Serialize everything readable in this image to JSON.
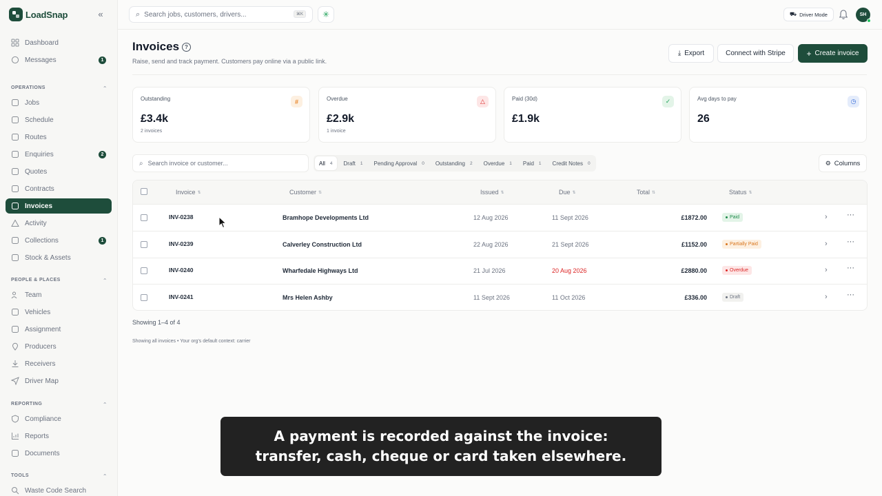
{
  "app": {
    "name": "LoadSnap"
  },
  "topbar": {
    "search_placeholder": "Search jobs, customers, drivers...",
    "search_shortcut": "⌘K",
    "driver_mode_label": "Driver Mode",
    "avatar_initials": "SH"
  },
  "sidebar": {
    "top_items": [
      {
        "label": "Dashboard",
        "icon": "dashboard-icon",
        "badge": ""
      },
      {
        "label": "Messages",
        "icon": "message-icon",
        "badge": "1"
      }
    ],
    "sections": [
      {
        "title": "OPERATIONS",
        "items": [
          {
            "label": "Jobs",
            "icon": "clipboard-icon",
            "badge": ""
          },
          {
            "label": "Schedule",
            "icon": "calendar-icon",
            "badge": ""
          },
          {
            "label": "Routes",
            "icon": "route-icon",
            "badge": ""
          },
          {
            "label": "Enquiries",
            "icon": "inbox-icon",
            "badge": "2"
          },
          {
            "label": "Quotes",
            "icon": "document-icon",
            "badge": ""
          },
          {
            "label": "Contracts",
            "icon": "contract-icon",
            "badge": ""
          },
          {
            "label": "Invoices",
            "icon": "invoice-icon",
            "badge": "",
            "active": true
          },
          {
            "label": "Activity",
            "icon": "activity-icon",
            "badge": ""
          },
          {
            "label": "Collections",
            "icon": "collections-icon",
            "badge": "1"
          },
          {
            "label": "Stock & Assets",
            "icon": "box-icon",
            "badge": ""
          }
        ]
      },
      {
        "title": "PEOPLE & PLACES",
        "items": [
          {
            "label": "Team",
            "icon": "team-icon",
            "badge": ""
          },
          {
            "label": "Vehicles",
            "icon": "truck-icon",
            "badge": ""
          },
          {
            "label": "Assignment",
            "icon": "assignment-icon",
            "badge": ""
          },
          {
            "label": "Producers",
            "icon": "pin-icon",
            "badge": ""
          },
          {
            "label": "Receivers",
            "icon": "download-icon",
            "badge": ""
          },
          {
            "label": "Driver Map",
            "icon": "navigation-icon",
            "badge": ""
          }
        ]
      },
      {
        "title": "REPORTING",
        "items": [
          {
            "label": "Compliance",
            "icon": "shield-icon",
            "badge": ""
          },
          {
            "label": "Reports",
            "icon": "bar-chart-icon",
            "badge": ""
          },
          {
            "label": "Documents",
            "icon": "file-icon",
            "badge": ""
          }
        ]
      },
      {
        "title": "TOOLS",
        "items": [
          {
            "label": "Waste Code Search",
            "icon": "search-icon",
            "badge": ""
          }
        ]
      }
    ]
  },
  "page": {
    "title": "Invoices",
    "subtitle": "Raise, send and track payment. Customers pay online via a public link.",
    "export_label": "Export",
    "stripe_label": "Connect with Stripe",
    "create_label": "Create invoice"
  },
  "kpis": [
    {
      "label": "Outstanding",
      "value": "£3.4k",
      "sub": "2 invoices",
      "icon": "#",
      "icon_name": "hash-icon",
      "bg": "#fdf0e1",
      "fg": "#e8862a"
    },
    {
      "label": "Overdue",
      "value": "£2.9k",
      "sub": "1 invoice",
      "icon": "△",
      "icon_name": "warning-icon",
      "bg": "#fde6e6",
      "fg": "#dc2626"
    },
    {
      "label": "Paid (30d)",
      "value": "£1.9k",
      "sub": "",
      "icon": "✓",
      "icon_name": "check-circle-icon",
      "bg": "#e3f4e8",
      "fg": "#22a35a"
    },
    {
      "label": "Avg days to pay",
      "value": "26",
      "sub": "",
      "icon": "◷",
      "icon_name": "clock-icon",
      "bg": "#e4ecfb",
      "fg": "#3b6fd8"
    }
  ],
  "filters": {
    "search_placeholder": "Search invoice or customer...",
    "chips": [
      {
        "label": "All",
        "count": "4",
        "active": true
      },
      {
        "label": "Draft",
        "count": "1"
      },
      {
        "label": "Pending Approval",
        "count": "0"
      },
      {
        "label": "Outstanding",
        "count": "2"
      },
      {
        "label": "Overdue",
        "count": "1"
      },
      {
        "label": "Paid",
        "count": "1"
      },
      {
        "label": "Credit Notes",
        "count": "0"
      }
    ],
    "columns_label": "Columns"
  },
  "table": {
    "headers": [
      "Invoice",
      "Customer",
      "Issued",
      "Due",
      "Total",
      "Status"
    ],
    "rows": [
      {
        "invoice": "INV-0238",
        "customer": "Bramhope Developments Ltd",
        "issued": "12 Aug 2026",
        "due": "11 Sept 2026",
        "total": "£1872.00",
        "status": "Paid",
        "status_bg": "#e3f4e8",
        "status_fg": "#1e8a4a",
        "overdue": false
      },
      {
        "invoice": "INV-0239",
        "customer": "Calverley Construction Ltd",
        "issued": "22 Aug 2026",
        "due": "21 Sept 2026",
        "total": "£1152.00",
        "status": "Partially Paid",
        "status_bg": "#fdf0e1",
        "status_fg": "#d9751c",
        "overdue": false
      },
      {
        "invoice": "INV-0240",
        "customer": "Wharfedale Highways Ltd",
        "issued": "21 Jul 2026",
        "due": "20 Aug 2026",
        "total": "£2880.00",
        "status": "Overdue",
        "status_bg": "#fde6e6",
        "status_fg": "#dc2626",
        "overdue": true
      },
      {
        "invoice": "INV-0241",
        "customer": "Mrs Helen Ashby",
        "issued": "11 Sept 2026",
        "due": "11 Oct 2026",
        "total": "£336.00",
        "status": "Draft",
        "status_bg": "#f1f1ef",
        "status_fg": "#6b7280",
        "overdue": false
      }
    ]
  },
  "footer": {
    "showing": "Showing 1–4 of 4",
    "context_note": "Showing all invoices • Your org's default context: carrier"
  },
  "caption": {
    "text": "A payment is recorded against the invoice:\ntransfer, cash, cheque or card taken elsewhere."
  }
}
